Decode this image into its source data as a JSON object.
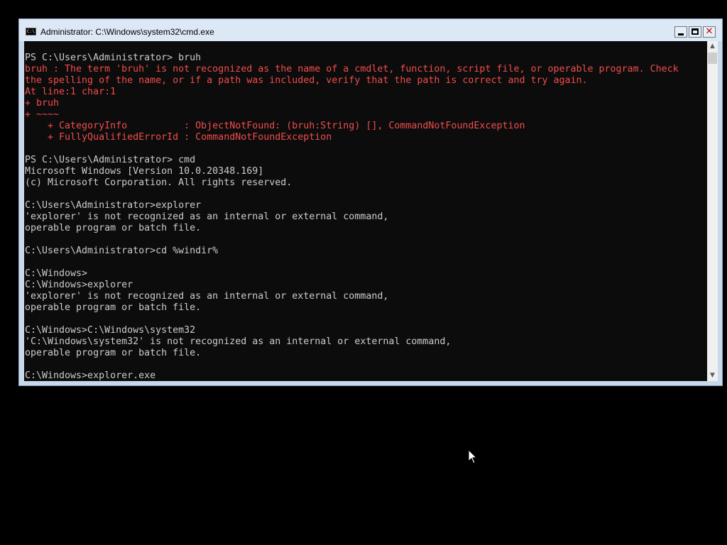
{
  "window": {
    "title": "Administrator: C:\\Windows\\system32\\cmd.exe",
    "app_icon_text": "C:\\",
    "app_icon": "cmd-icon",
    "controls": {
      "minimize": "minimize-icon",
      "maximize": "maximize-icon",
      "close_glyph": "✕"
    }
  },
  "console": {
    "colors": {
      "background": "#0c0c0c",
      "normal_text": "#cccccc",
      "error_text": "#f14c4c"
    },
    "lines": [
      {
        "text": "PS C:\\Users\\Administrator> bruh",
        "style": "normal"
      },
      {
        "text": "bruh : The term 'bruh' is not recognized as the name of a cmdlet, function, script file, or operable program. Check",
        "style": "error"
      },
      {
        "text": "the spelling of the name, or if a path was included, verify that the path is correct and try again.",
        "style": "error"
      },
      {
        "text": "At line:1 char:1",
        "style": "error"
      },
      {
        "text": "+ bruh",
        "style": "error"
      },
      {
        "text": "+ ~~~~",
        "style": "error"
      },
      {
        "text": "    + CategoryInfo          : ObjectNotFound: (bruh:String) [], CommandNotFoundException",
        "style": "error"
      },
      {
        "text": "    + FullyQualifiedErrorId : CommandNotFoundException",
        "style": "error"
      },
      {
        "text": "",
        "style": "normal"
      },
      {
        "text": "PS C:\\Users\\Administrator> cmd",
        "style": "normal"
      },
      {
        "text": "Microsoft Windows [Version 10.0.20348.169]",
        "style": "normal"
      },
      {
        "text": "(c) Microsoft Corporation. All rights reserved.",
        "style": "normal"
      },
      {
        "text": "",
        "style": "normal"
      },
      {
        "text": "C:\\Users\\Administrator>explorer",
        "style": "normal"
      },
      {
        "text": "'explorer' is not recognized as an internal or external command,",
        "style": "normal"
      },
      {
        "text": "operable program or batch file.",
        "style": "normal"
      },
      {
        "text": "",
        "style": "normal"
      },
      {
        "text": "C:\\Users\\Administrator>cd %windir%",
        "style": "normal"
      },
      {
        "text": "",
        "style": "normal"
      },
      {
        "text": "C:\\Windows>",
        "style": "normal"
      },
      {
        "text": "C:\\Windows>explorer",
        "style": "normal"
      },
      {
        "text": "'explorer' is not recognized as an internal or external command,",
        "style": "normal"
      },
      {
        "text": "operable program or batch file.",
        "style": "normal"
      },
      {
        "text": "",
        "style": "normal"
      },
      {
        "text": "C:\\Windows>C:\\Windows\\system32",
        "style": "normal"
      },
      {
        "text": "'C:\\Windows\\system32' is not recognized as an internal or external command,",
        "style": "normal"
      },
      {
        "text": "operable program or batch file.",
        "style": "normal"
      },
      {
        "text": "",
        "style": "normal"
      },
      {
        "text": "C:\\Windows>explorer.exe",
        "style": "normal"
      }
    ]
  },
  "scrollbar": {
    "up_arrow": "▲",
    "down_arrow": "▼"
  },
  "mouse_cursor": "arrow-cursor-icon"
}
